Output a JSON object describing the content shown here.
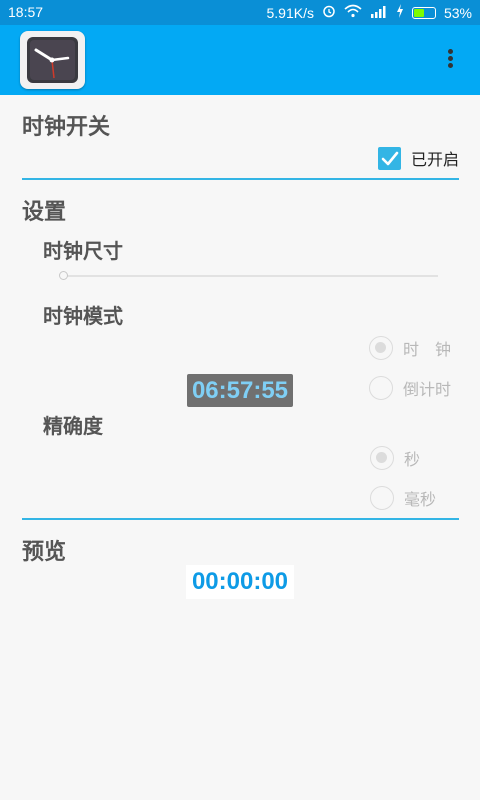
{
  "status_bar": {
    "time": "18:57",
    "net_speed": "5.91K/s",
    "battery_percent": "53%",
    "battery_level": 0.53,
    "icons": [
      "alarm-icon",
      "wifi-icon",
      "signal-icon",
      "charging-icon",
      "battery-icon"
    ]
  },
  "app_bar": {
    "icon": "clock-app-icon",
    "menu_icon": "overflow-menu-icon"
  },
  "clock_switch": {
    "title": "时钟开关",
    "checkbox_label": "已开启",
    "checked": true
  },
  "settings": {
    "title": "设置",
    "size": {
      "label": "时钟尺寸",
      "value": 0
    },
    "mode": {
      "label": "时钟模式",
      "options": [
        "时　钟",
        "倒计时"
      ],
      "selected": "时　钟"
    },
    "clock_display": "06:57:55",
    "precision": {
      "label": "精确度",
      "options": [
        "秒",
        "毫秒"
      ],
      "selected": "秒"
    }
  },
  "preview": {
    "title": "预览",
    "display": "00:00:00"
  },
  "colors": {
    "primary": "#03a9f4",
    "status": "#0a8fd6",
    "accent": "#33b5e5",
    "preview_text": "#0e9be6"
  }
}
